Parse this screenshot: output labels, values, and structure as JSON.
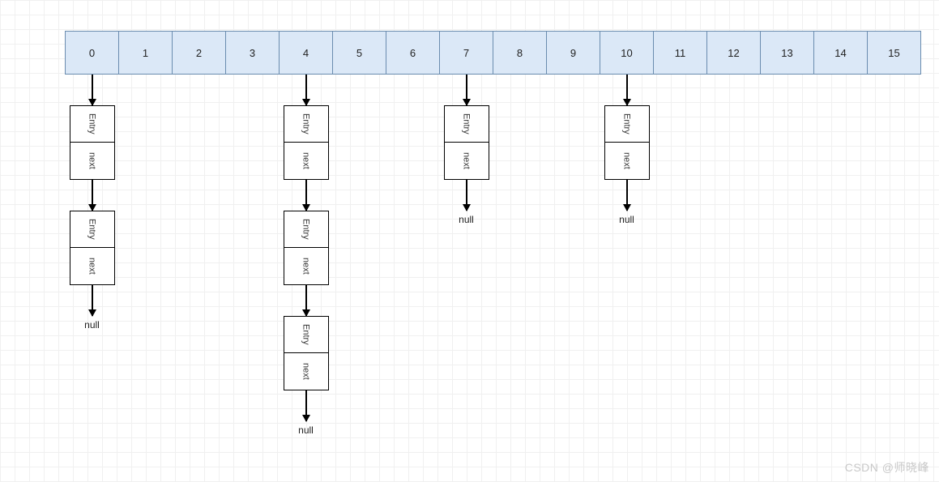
{
  "array": {
    "cells": [
      "0",
      "1",
      "2",
      "3",
      "4",
      "5",
      "6",
      "7",
      "8",
      "9",
      "10",
      "11",
      "12",
      "13",
      "14",
      "15"
    ]
  },
  "entry": {
    "top_label": "Entry",
    "bottom_label": "next"
  },
  "null_label": "null",
  "chains": [
    {
      "index": 0,
      "entries": 2
    },
    {
      "index": 4,
      "entries": 3
    },
    {
      "index": 7,
      "entries": 1
    },
    {
      "index": 10,
      "entries": 1
    }
  ],
  "watermark": "CSDN @师晓峰"
}
